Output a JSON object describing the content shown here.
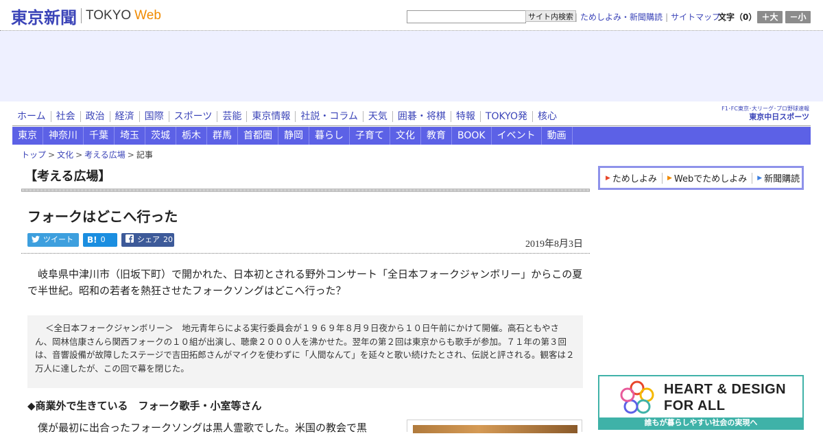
{
  "header": {
    "logo_jp": "東京新聞",
    "logo_en": "TOKYO",
    "logo_web": "Web",
    "search_placeholder": "",
    "search_button": "サイト内検索",
    "links": [
      "ためしよみ・新聞購読",
      "サイトマップ"
    ],
    "font_size_label": "文字（0）",
    "font_plus": "＋大",
    "font_minus": "－小"
  },
  "global_nav": [
    "ホーム",
    "社会",
    "政治",
    "経済",
    "国際",
    "スポーツ",
    "芸能",
    "東京情報",
    "社説・コラム",
    "天気",
    "囲碁・将棋",
    "特報",
    "TOKYO発",
    "核心"
  ],
  "chunichi": {
    "top": "F1･FC東京･大リーグ･プロ野球速報",
    "bottom": "東京中日スポーツ"
  },
  "regional_nav": [
    "東京",
    "神奈川",
    "千葉",
    "埼玉",
    "茨城",
    "栃木",
    "群馬",
    "首都圏",
    "静岡",
    "暮らし",
    "子育て",
    "文化",
    "教育",
    "BOOK",
    "イベント",
    "動画"
  ],
  "breadcrumb": [
    "トップ",
    "文化",
    "考える広場",
    "記事"
  ],
  "article": {
    "section": "【考える広場】",
    "title": "フォークはどこへ行った",
    "date": "2019年8月3日",
    "share": {
      "tweet_label": "ツイート",
      "hatena_icon": "B!",
      "hatena_count": "0",
      "facebook_label": "シェア",
      "facebook_count": "20"
    },
    "lead": "岐阜県中津川市（旧坂下町）で開かれた、日本初とされる野外コンサート「全日本フォークジャンボリー」からこの夏で半世紀。昭和の若者を熱狂させたフォークソングはどこへ行った？",
    "note": "＜全日本フォークジャンボリー＞　地元青年らによる実行委員会が１９６９年８月９日夜から１０日午前にかけて開催。高石ともやさん、岡林信康さんら関西フォークの１０組が出演し、聴衆２０００人を沸かせた。翌年の第２回は東京からも歌手が参加。７１年の第３回は、音響設備が故障したステージで吉田拓郎さんがマイクを使わずに「人間なんて」を延々と歌い続けたとされ、伝説と評される。観客は２万人に達したが、この回で幕を閉じた。",
    "subhead": "◆商業外で生きている　フォーク歌手・小室等さん",
    "body": "僕が最初に出合ったフォークソングは黒人霊歌でした。米国の教会で黒"
  },
  "sidebar": {
    "subscribe_links": [
      "ためしよみ",
      "Webでためしよみ",
      "新聞購読"
    ],
    "banner_title1": "HEART & DESIGN",
    "banner_title2": "FOR ALL",
    "banner_caption": "誰もが暮らしやすい社会の実現へ"
  },
  "colors": {
    "brand_blue": "#3b44b8",
    "nav_bar": "#5c61e6",
    "accent_orange": "#f08a00",
    "teal": "#3fb2a8"
  }
}
